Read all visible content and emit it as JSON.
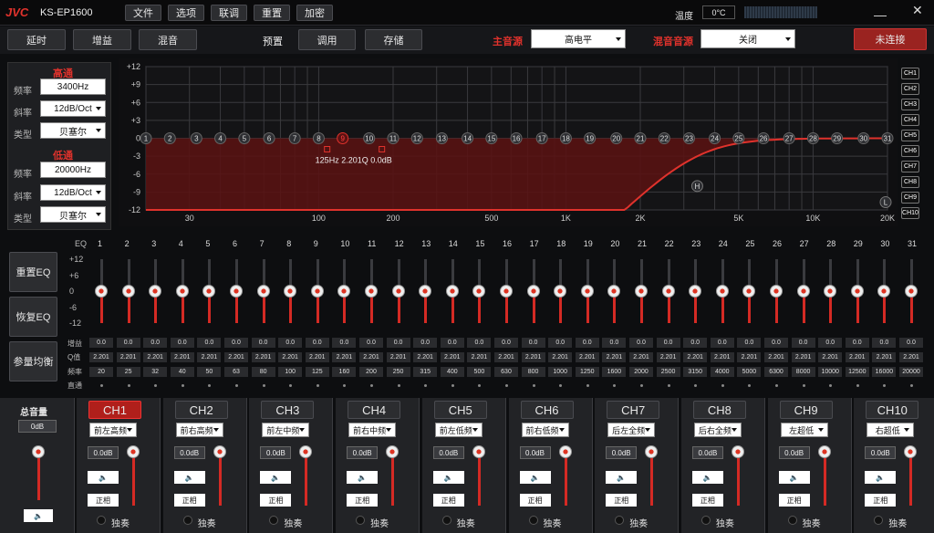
{
  "titlebar": {
    "brand": "JVC",
    "model": "KS-EP1600",
    "menu": [
      "文件",
      "选项",
      "联调",
      "重置",
      "加密"
    ],
    "temp_label": "温度",
    "temp_value": "0°C"
  },
  "toolbar": {
    "buttons": [
      "延时",
      "增益",
      "混音"
    ],
    "preset_label": "预置",
    "preset_buttons": [
      "调用",
      "存储"
    ],
    "main_src_label": "主音源",
    "main_src_value": "高电平",
    "mix_src_label": "混音音源",
    "mix_src_value": "关闭",
    "connect_label": "未连接"
  },
  "filter": {
    "hp_title": "高通",
    "lp_title": "低通",
    "freq_label": "频率",
    "slope_label": "斜率",
    "type_label": "类型",
    "hp_freq": "3400Hz",
    "hp_slope": "12dB/Oct",
    "hp_type": "贝塞尔",
    "lp_freq": "20000Hz",
    "lp_slope": "12dB/Oct",
    "lp_type": "贝塞尔"
  },
  "graph": {
    "y_ticks": [
      "+12",
      "+9",
      "+6",
      "+3",
      "0",
      "-3",
      "-6",
      "-9",
      "-12"
    ],
    "x_ticks": [
      "30",
      "100",
      "200",
      "500",
      "1K",
      "2K",
      "5K",
      "10K",
      "20K"
    ],
    "point_info": "125Hz  2.201Q  0.0dB",
    "h_marker": "H",
    "l_marker": "L",
    "selected_point": 9
  },
  "channels_side": [
    "CH1",
    "CH2",
    "CH3",
    "CH4",
    "CH5",
    "CH6",
    "CH7",
    "CH8",
    "CH9",
    "CH10"
  ],
  "eq": {
    "label": "EQ",
    "scale": [
      "+12",
      "+6",
      "0",
      "-6",
      "-12"
    ],
    "reset_btn": "重置EQ",
    "restore_btn": "恢复EQ",
    "param_btn": "参量均衡",
    "gain_label": "增益",
    "q_label": "Q值",
    "freq_label": "频率",
    "bypass_label": "直通",
    "bands": [
      "1",
      "2",
      "3",
      "4",
      "5",
      "6",
      "7",
      "8",
      "9",
      "10",
      "11",
      "12",
      "13",
      "14",
      "15",
      "16",
      "17",
      "18",
      "19",
      "20",
      "21",
      "22",
      "23",
      "24",
      "25",
      "26",
      "27",
      "28",
      "29",
      "30",
      "31"
    ],
    "gain": "0.0",
    "q": "2.201",
    "freqs": [
      "20",
      "25",
      "32",
      "40",
      "50",
      "63",
      "80",
      "100",
      "125",
      "160",
      "200",
      "250",
      "315",
      "400",
      "500",
      "630",
      "800",
      "1000",
      "1250",
      "1600",
      "2000",
      "2500",
      "3150",
      "4000",
      "5000",
      "6300",
      "8000",
      "10000",
      "12500",
      "16000",
      "20000"
    ]
  },
  "master": {
    "label": "总音量",
    "value": "0dB"
  },
  "ch_strip": {
    "gain": "0.0dB",
    "invert": "正相",
    "solo": "独奏",
    "names": [
      "CH1",
      "CH2",
      "CH3",
      "CH4",
      "CH5",
      "CH6",
      "CH7",
      "CH8",
      "CH9",
      "CH10"
    ],
    "positions": [
      "前左高频",
      "前右高频",
      "前左中频",
      "前右中频",
      "前左低频",
      "前右低频",
      "后左全频",
      "后右全频",
      "左超低",
      "右超低"
    ],
    "active": 0
  },
  "colors": {
    "accent": "#e0322c",
    "bg": "#0d0e10",
    "panel": "#222326"
  }
}
